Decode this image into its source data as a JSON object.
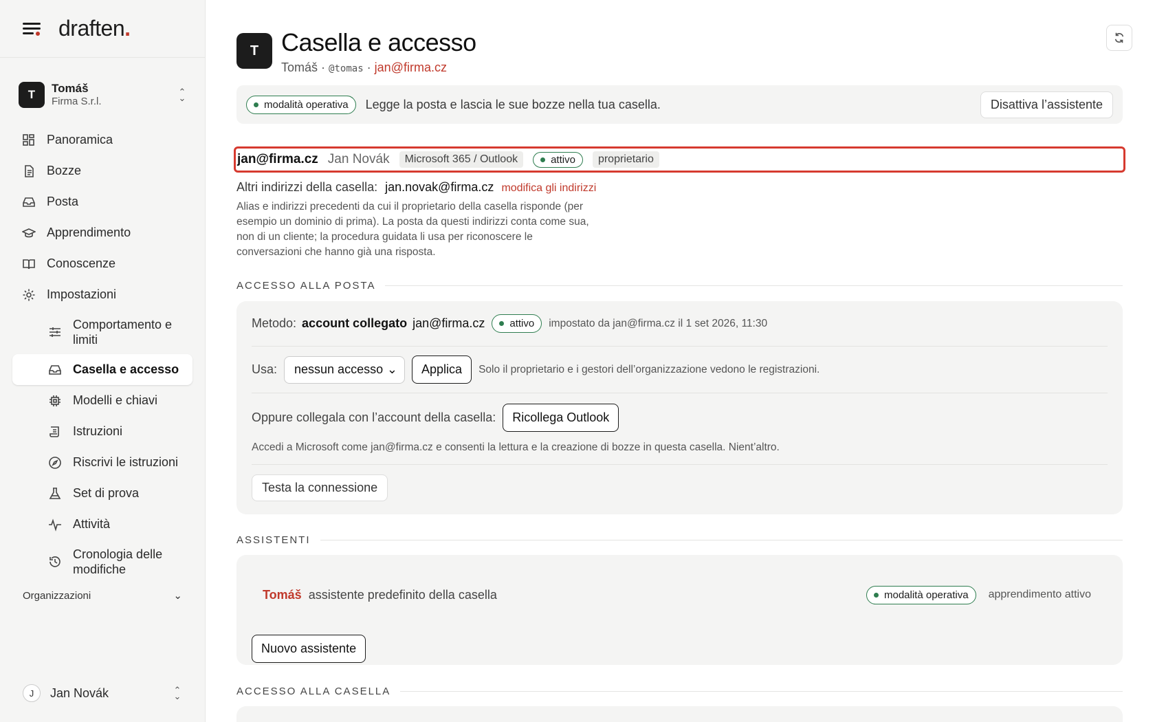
{
  "brand": {
    "name": "draften",
    "dot": "."
  },
  "account": {
    "initial": "T",
    "name": "Tomáš",
    "org": "Firma S.r.l."
  },
  "nav": {
    "items": [
      {
        "label": "Panoramica",
        "icon": "grid-icon"
      },
      {
        "label": "Bozze",
        "icon": "document-icon"
      },
      {
        "label": "Posta",
        "icon": "inbox-icon"
      },
      {
        "label": "Apprendimento",
        "icon": "graduation-cap-icon"
      },
      {
        "label": "Conoscenze",
        "icon": "book-icon"
      },
      {
        "label": "Impostazioni",
        "icon": "gear-icon"
      }
    ],
    "sub_items": [
      {
        "label": "Comportamento e limiti",
        "icon": "sliders-icon"
      },
      {
        "label": "Casella e accesso",
        "icon": "inbox-icon"
      },
      {
        "label": "Modelli e chiavi",
        "icon": "chip-icon"
      },
      {
        "label": "Istruzioni",
        "icon": "scroll-icon"
      },
      {
        "label": "Riscrivi le istruzioni",
        "icon": "compass-icon"
      },
      {
        "label": "Set di prova",
        "icon": "flask-icon"
      },
      {
        "label": "Attività",
        "icon": "activity-icon"
      },
      {
        "label": "Cronologia delle modifiche",
        "icon": "history-icon"
      }
    ],
    "active": "Casella e accesso"
  },
  "organizations_label": "Organizzazioni",
  "user": {
    "initial": "J",
    "name": "Jan Novák"
  },
  "header": {
    "avatar_initial": "T",
    "title": "Casella e accesso",
    "name": "Tomáš",
    "sep1": "·",
    "handle": "@tomas",
    "sep2": "·",
    "email": "jan@firma.cz"
  },
  "mode_bar": {
    "badge": "modalità operativa",
    "description": "Legge la posta e lascia le sue bozze nella tua casella.",
    "deactivate_label": "Disattiva l’assistente"
  },
  "mailbox": {
    "address": "jan@firma.cz",
    "owner_name": "Jan Novák",
    "provider": "Microsoft 365 / Outlook",
    "status": "attivo",
    "role": "proprietario"
  },
  "aliases": {
    "label": "Altri indirizzi della casella:",
    "value": "jan.novak@firma.cz",
    "edit_link": "modifica gli indirizzi",
    "help": "Alias e indirizzi precedenti da cui il proprietario della casella risponde (per esempio un dominio di prima). La posta da questi indirizzi conta come sua, non di un cliente; la procedura guidata li usa per riconoscere le conversazioni che hanno già una risposta."
  },
  "mail_access": {
    "section_title": "ACCESSO ALLA POSTA",
    "method_label": "Metodo:",
    "method_value": "account collegato",
    "method_account": "jan@firma.cz",
    "method_status": "attivo",
    "method_info": "impostato da jan@firma.cz il 1 set 2026, 11:30",
    "use_label": "Usa:",
    "use_selected": "nessun accesso",
    "apply_label": "Applica",
    "use_note": "Solo il proprietario e i gestori dell’organizzazione vedono le registrazioni.",
    "relink_label": "Oppure collegala con l’account della casella:",
    "relink_button": "Ricollega Outlook",
    "relink_note": "Accedi a Microsoft come jan@firma.cz e consenti la lettura e la creazione di bozze in questa casella. Nient’altro.",
    "test_button": "Testa la connessione"
  },
  "assistants": {
    "section_title": "ASSISTENTI",
    "name": "Tomáš",
    "description": "assistente predefinito della casella",
    "mode_badge": "modalità operativa",
    "learning": "apprendimento attivo",
    "new_button": "Nuovo assistente"
  },
  "mailbox_access": {
    "section_title": "ACCESSO ALLA CASELLA"
  },
  "colors": {
    "accent_red": "#c0392b",
    "status_green": "#2e7d4f",
    "highlight_border": "#d63a2f"
  }
}
